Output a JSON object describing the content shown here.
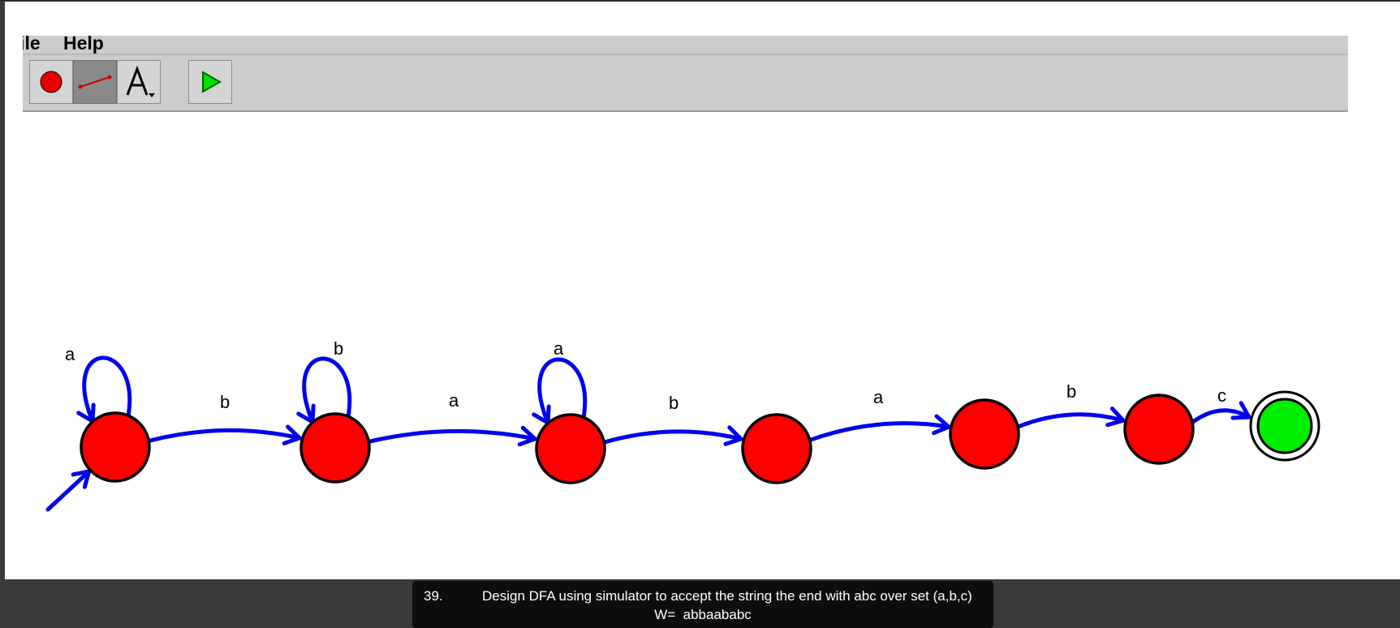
{
  "menu": {
    "items": [
      {
        "label": "File"
      },
      {
        "label": "Help"
      }
    ]
  },
  "toolbar": {
    "tools": [
      {
        "name": "state-tool",
        "icon": "state-circle-icon",
        "pressed": false
      },
      {
        "name": "transition-tool",
        "icon": "transition-arrow-icon",
        "pressed": true
      },
      {
        "name": "label-tool",
        "icon": "text-A-icon",
        "pressed": false
      },
      {
        "name": "run-tool",
        "icon": "play-icon",
        "pressed": false
      }
    ]
  },
  "automaton": {
    "state_colors": {
      "normal": "#ff0000",
      "final": "#00ee00",
      "edge": "#0000ee"
    },
    "states": [
      {
        "id": "q0",
        "initial": true,
        "final": false
      },
      {
        "id": "q1",
        "initial": false,
        "final": false
      },
      {
        "id": "q2",
        "initial": false,
        "final": false
      },
      {
        "id": "q3",
        "initial": false,
        "final": false
      },
      {
        "id": "q4",
        "initial": false,
        "final": false
      },
      {
        "id": "q5",
        "initial": false,
        "final": false
      },
      {
        "id": "q6",
        "initial": false,
        "final": true
      }
    ],
    "transitions": [
      {
        "from": "q0",
        "to": "q0",
        "label": "a"
      },
      {
        "from": "q0",
        "to": "q1",
        "label": "b"
      },
      {
        "from": "q1",
        "to": "q1",
        "label": "b"
      },
      {
        "from": "q1",
        "to": "q2",
        "label": "a"
      },
      {
        "from": "q2",
        "to": "q2",
        "label": "a"
      },
      {
        "from": "q2",
        "to": "q3",
        "label": "b"
      },
      {
        "from": "q3",
        "to": "q4",
        "label": "a"
      },
      {
        "from": "q4",
        "to": "q5",
        "label": "b"
      },
      {
        "from": "q5",
        "to": "q6",
        "label": "c"
      }
    ]
  },
  "caption": {
    "number": "39.",
    "text": "Design DFA using simulator to accept the string the end with abc over set (a,b,c)",
    "line2": "W=  abbaababc"
  }
}
